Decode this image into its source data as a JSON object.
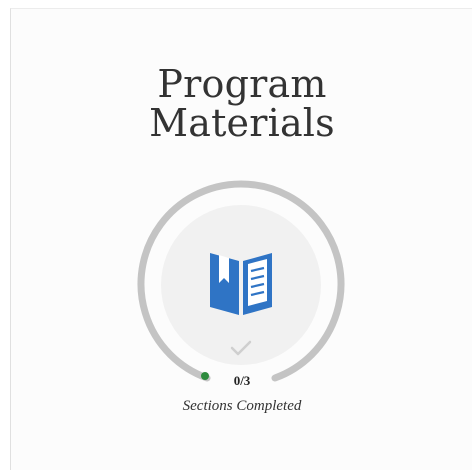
{
  "module": {
    "title_line1": "Program",
    "title_line2": "Materials",
    "progress": {
      "completed": 0,
      "total": 3,
      "label": "0/3",
      "caption": "Sections Completed"
    },
    "icon": "book-icon",
    "status_icon": "checkmark-icon"
  },
  "colors": {
    "ring_track": "#c4c4c4",
    "ring_start_dot": "#2e8b3e",
    "inner_circle": "#f1f1f1",
    "book_blue": "#2f74c5",
    "check_gray": "#cfcfcf",
    "title_text": "#333333"
  }
}
